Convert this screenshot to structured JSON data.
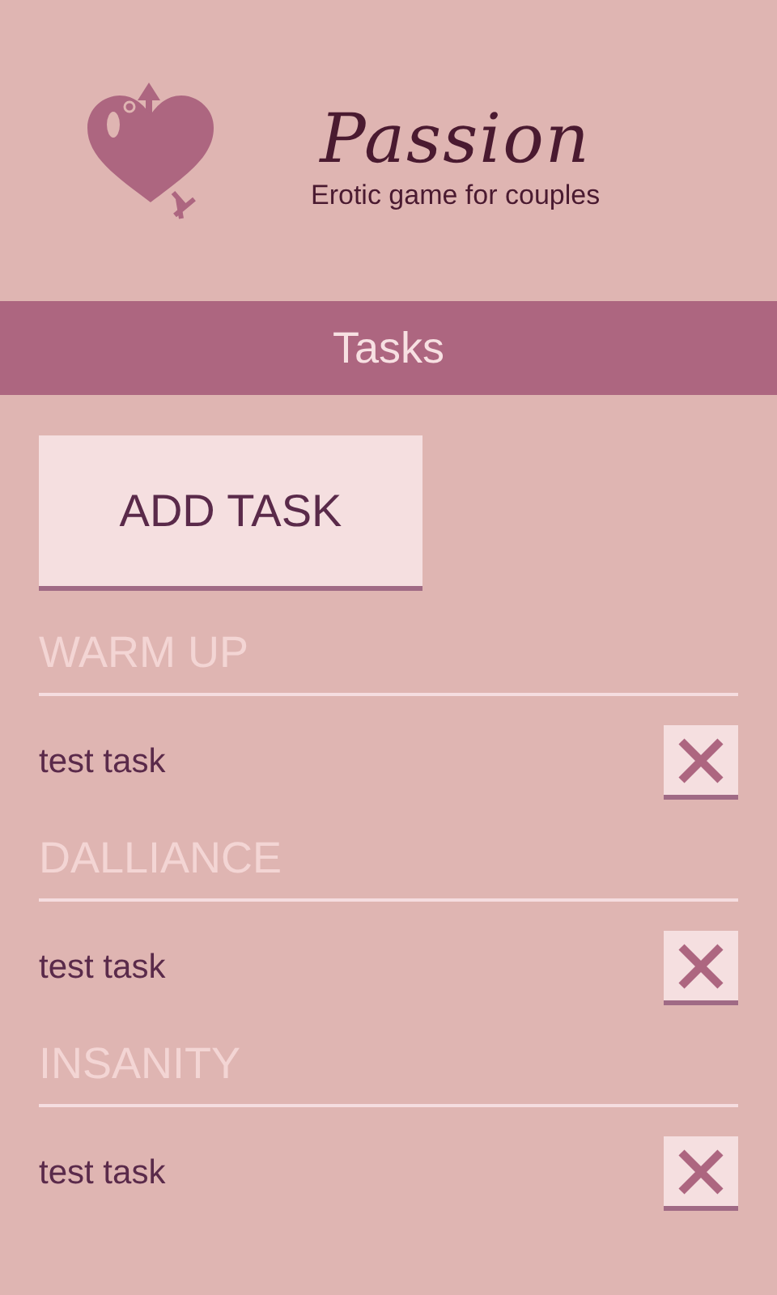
{
  "header": {
    "title": "Passion",
    "subtitle": "Erotic game for couples"
  },
  "title_bar": {
    "title": "Tasks"
  },
  "add_button": {
    "label": "ADD TASK"
  },
  "sections": [
    {
      "title": "WARM UP",
      "tasks": [
        {
          "text": "test task"
        }
      ]
    },
    {
      "title": "DALLIANCE",
      "tasks": [
        {
          "text": "test task"
        }
      ]
    },
    {
      "title": "INSANITY",
      "tasks": [
        {
          "text": "test task"
        }
      ]
    }
  ]
}
